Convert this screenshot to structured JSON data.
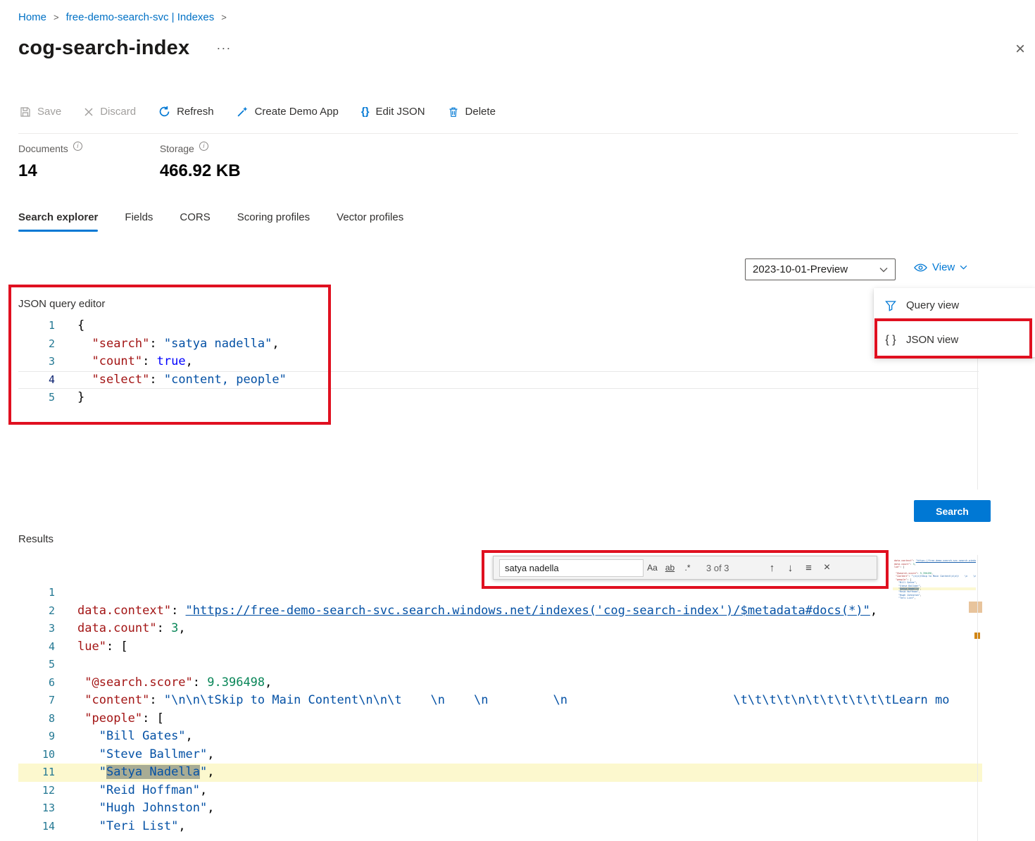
{
  "colors": {
    "accent": "#0078d4",
    "annotation": "#e01020",
    "match_highlight": "#a8ac94",
    "match_line": "#fcf8ce"
  },
  "breadcrumb": {
    "items": [
      "Home",
      "free-demo-search-svc | Indexes"
    ],
    "separator": ">"
  },
  "header": {
    "title": "cog-search-index",
    "more": "···",
    "close": "×"
  },
  "toolbar": [
    {
      "label": "Save",
      "disabled": true
    },
    {
      "label": "Discard",
      "disabled": true
    },
    {
      "label": "Refresh",
      "disabled": false
    },
    {
      "label": "Create Demo App",
      "disabled": false
    },
    {
      "label": "Edit JSON",
      "disabled": false,
      "glyph": "{}"
    },
    {
      "label": "Delete",
      "disabled": false
    }
  ],
  "stats": [
    {
      "label": "Documents",
      "value": "14",
      "info": "i"
    },
    {
      "label": "Storage",
      "value": "466.92 KB",
      "info": "i"
    }
  ],
  "tabs": [
    {
      "label": "Search explorer",
      "active": true
    },
    {
      "label": "Fields",
      "active": false
    },
    {
      "label": "CORS",
      "active": false
    },
    {
      "label": "Scoring profiles",
      "active": false
    },
    {
      "label": "Vector profiles",
      "active": false
    }
  ],
  "query_controls": {
    "api_version": "2023-10-01-Preview",
    "view_label": "View"
  },
  "view_menu": [
    {
      "label": "Query view"
    },
    {
      "label": "JSON view",
      "glyph": "{ }"
    }
  ],
  "query_editor": {
    "label": "JSON query editor",
    "lines": [
      {
        "n": 1,
        "s": [
          [
            "p",
            "{"
          ]
        ]
      },
      {
        "n": 2,
        "s": [
          [
            "p",
            "  "
          ],
          [
            "k",
            "\"search\""
          ],
          [
            "p",
            ": "
          ],
          [
            "s",
            "\"satya nadella\""
          ],
          [
            "p",
            ","
          ]
        ]
      },
      {
        "n": 3,
        "s": [
          [
            "p",
            "  "
          ],
          [
            "k",
            "\"count\""
          ],
          [
            "p",
            ": "
          ],
          [
            "b",
            "true"
          ],
          [
            "p",
            ","
          ]
        ]
      },
      {
        "n": 4,
        "c": "current",
        "s": [
          [
            "p",
            "  "
          ],
          [
            "k",
            "\"select\""
          ],
          [
            "p",
            ": "
          ],
          [
            "s",
            "\"content, people\""
          ]
        ]
      },
      {
        "n": 5,
        "s": [
          [
            "p",
            "}"
          ]
        ]
      }
    ]
  },
  "search_button": {
    "label": "Search"
  },
  "results": {
    "label": "Results"
  },
  "find_widget": {
    "value": "satya nadella",
    "match_case": "Aa",
    "whole_word": "ab",
    "regex": ".*",
    "count": "3 of 3",
    "prev": "↑",
    "next": "↓",
    "selection": "≡",
    "close": "×"
  },
  "results_editor": {
    "lines": [
      {
        "n": 1,
        "s": []
      },
      {
        "n": 2,
        "s": [
          [
            "k",
            "data.context\""
          ],
          [
            "p",
            ": "
          ],
          [
            "l",
            "\"https://free-demo-search-svc.search.windows.net/indexes('cog-search-index')/$metadata#docs(*)\""
          ],
          [
            "p",
            ","
          ]
        ]
      },
      {
        "n": 3,
        "s": [
          [
            "k",
            "data.count\""
          ],
          [
            "p",
            ": "
          ],
          [
            "n2",
            "3"
          ],
          [
            "p",
            ","
          ]
        ]
      },
      {
        "n": 4,
        "s": [
          [
            "k",
            "lue\""
          ],
          [
            "p",
            ": ["
          ]
        ]
      },
      {
        "n": 5,
        "s": []
      },
      {
        "n": 6,
        "s": [
          [
            "p",
            " "
          ],
          [
            "k",
            "\"@search.score\""
          ],
          [
            "p",
            ": "
          ],
          [
            "n2",
            "9.396498"
          ],
          [
            "p",
            ","
          ]
        ]
      },
      {
        "n": 7,
        "s": [
          [
            "p",
            " "
          ],
          [
            "k",
            "\"content\""
          ],
          [
            "p",
            ": "
          ],
          [
            "s",
            "\"\\n\\n\\tSkip to Main Content\\n\\n\\t    \\n    \\n         \\n                       \\t\\t\\t\\t\\n\\t\\t\\t\\t\\t\\tLearn mo"
          ]
        ]
      },
      {
        "n": 8,
        "s": [
          [
            "p",
            " "
          ],
          [
            "k",
            "\"people\""
          ],
          [
            "p",
            ": ["
          ]
        ]
      },
      {
        "n": 9,
        "s": [
          [
            "p",
            "   "
          ],
          [
            "s",
            "\"Bill Gates\""
          ],
          [
            "p",
            ","
          ]
        ]
      },
      {
        "n": 10,
        "s": [
          [
            "p",
            "   "
          ],
          [
            "s",
            "\"Steve Ballmer\""
          ],
          [
            "p",
            ","
          ]
        ]
      },
      {
        "n": 11,
        "c": "match-line",
        "s": [
          [
            "p",
            "   "
          ],
          [
            "s",
            "\""
          ],
          [
            "s match",
            "Satya Nadella"
          ],
          [
            "s",
            "\""
          ],
          [
            "p",
            ","
          ]
        ]
      },
      {
        "n": 12,
        "s": [
          [
            "p",
            "   "
          ],
          [
            "s",
            "\"Reid Hoffman\""
          ],
          [
            "p",
            ","
          ]
        ]
      },
      {
        "n": 13,
        "s": [
          [
            "p",
            "   "
          ],
          [
            "s",
            "\"Hugh Johnston\""
          ],
          [
            "p",
            ","
          ]
        ]
      },
      {
        "n": 14,
        "s": [
          [
            "p",
            "   "
          ],
          [
            "s",
            "\"Teri List\""
          ],
          [
            "p",
            ","
          ]
        ]
      }
    ]
  }
}
